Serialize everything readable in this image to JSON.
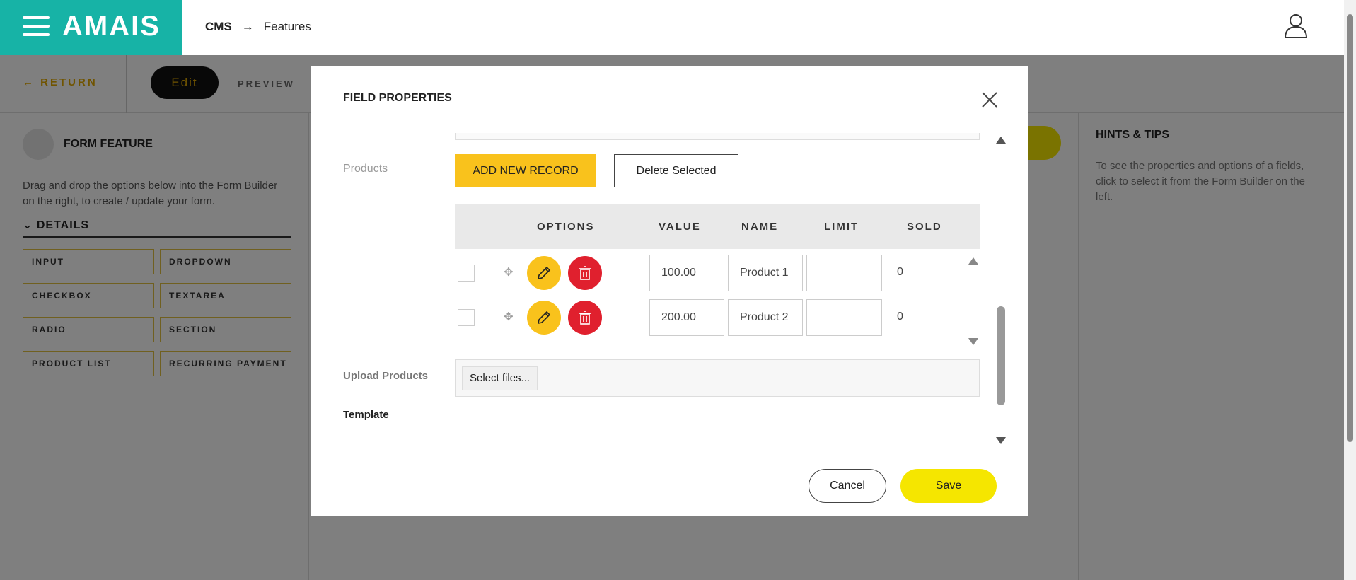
{
  "header": {
    "brand": "AMAIS",
    "breadcrumb": [
      "CMS",
      "Features"
    ]
  },
  "subbar": {
    "return_label": "RETURN",
    "edit_label": "Edit",
    "preview_label": "PREVIEW"
  },
  "left_panel": {
    "title": "FORM FEATURE",
    "description": "Drag and drop the options below into the Form Builder on the right, to create / update your form.",
    "section": "DETAILS",
    "items": [
      "INPUT",
      "DROPDOWN",
      "CHECKBOX",
      "TEXTAREA",
      "RADIO",
      "SECTION",
      "PRODUCT LIST",
      "RECURRING PAYMENT"
    ]
  },
  "right_panel": {
    "title": "HINTS & TIPS",
    "description": "To see the properties and options of a fields, click to select it from the Form Builder on the left."
  },
  "modal": {
    "title": "FIELD PROPERTIES",
    "products_label": "Products",
    "add_button": "ADD NEW RECORD",
    "delete_button": "Delete Selected",
    "table": {
      "headers": [
        "OPTIONS",
        "VALUE",
        "NAME",
        "LIMIT",
        "SOLD"
      ],
      "rows": [
        {
          "value": "100.00",
          "name": "Product 1",
          "limit": "",
          "sold": "0"
        },
        {
          "value": "200.00",
          "name": "Product 2",
          "limit": "",
          "sold": "0"
        }
      ]
    },
    "upload_label": "Upload Products",
    "select_files": "Select files...",
    "template_label": "Template",
    "cancel": "Cancel",
    "save": "Save"
  },
  "colors": {
    "brand": "#17b3a6",
    "accent_yellow": "#f9c21c",
    "save_yellow": "#f5e600",
    "danger": "#e0202e"
  }
}
